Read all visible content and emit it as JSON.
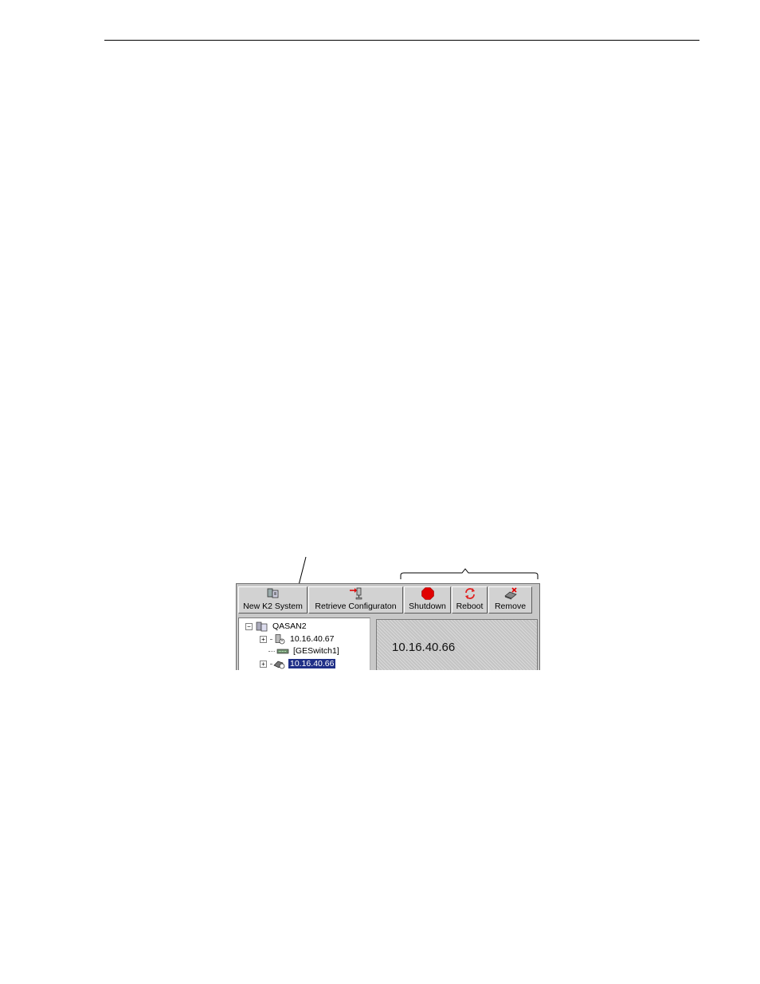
{
  "toolbar": {
    "new_system": "New K2 System",
    "retrieve": "Retrieve Configuraton",
    "shutdown": "Shutdown",
    "reboot": "Reboot",
    "remove": "Remove"
  },
  "tree": {
    "root": "QASAN2",
    "nodes": [
      {
        "label": "10.16.40.67",
        "icon": "server-icon"
      },
      {
        "label": "[GESwitch1]",
        "icon": "switch-icon"
      },
      {
        "label": "10.16.40.66",
        "icon": "media-server-icon",
        "selected": true
      }
    ]
  },
  "detail": {
    "title": "10.16.40.66"
  },
  "colors": {
    "selection": "#1f2f87",
    "shutdown_red": "#e00000",
    "reboot_red": "#e02020",
    "panel_gray": "#c8c8c8"
  }
}
